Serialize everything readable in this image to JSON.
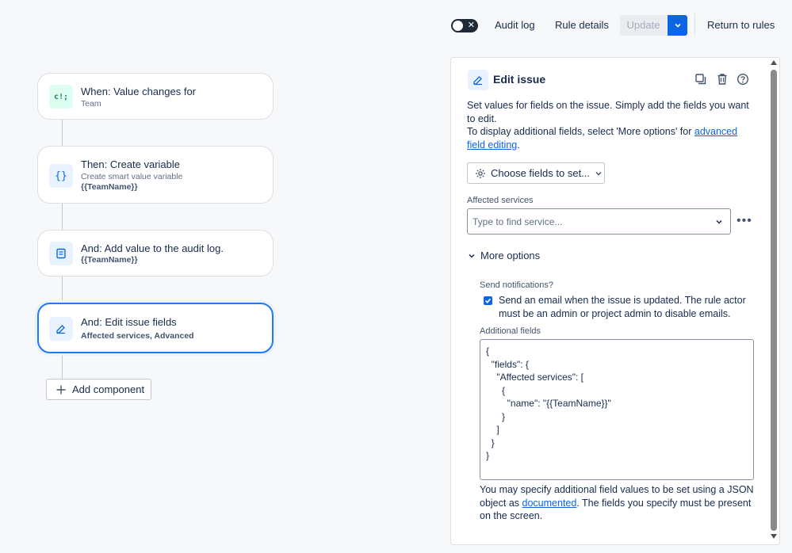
{
  "toolbar": {
    "audit_log": "Audit log",
    "rule_details": "Rule details",
    "update": "Update",
    "return_to_rules": "Return to rules",
    "toggle_state": "off"
  },
  "flow": {
    "nodes": [
      {
        "title": "When: Value changes for",
        "sub": "Team",
        "icon": "smart-value-icon"
      },
      {
        "title": "Then: Create variable",
        "sub": "Create smart value variable",
        "extra": "{{TeamName}}",
        "icon": "braces-icon"
      },
      {
        "title": "And: Add value to the audit log.",
        "extra": "{{TeamName}}",
        "icon": "audit-log-icon"
      },
      {
        "title": "And: Edit issue fields",
        "extra": "Affected services,  Advanced",
        "icon": "edit-icon"
      }
    ],
    "add_component": "Add component"
  },
  "panel": {
    "title": "Edit issue",
    "desc_line1": "Set values for fields on the issue. Simply add the fields you want to edit.",
    "desc_line2_pre": "To display additional fields, select 'More options' for ",
    "desc_link": "advanced field editing",
    "desc_line2_post": ".",
    "choose_fields": "Choose fields to set...",
    "affected_label": "Affected services",
    "affected_placeholder": "Type to find service...",
    "more_options": "More options",
    "send_notif_label": "Send notifications?",
    "send_notif_text": "Send an email when the issue is updated. The rule actor must be an admin or project admin to disable emails.",
    "send_notif_checked": true,
    "additional_label": "Additional fields",
    "additional_value": "{\n  \"fields\": {\n    \"Affected services\": [\n      {\n        \"name\": \"{{TeamName}}\"\n      }\n    ]\n  }\n}",
    "help_pre": "You may specify additional field values to be set using a JSON object as ",
    "help_link": "documented",
    "help_post": ". The fields you specify must be present on the screen."
  }
}
